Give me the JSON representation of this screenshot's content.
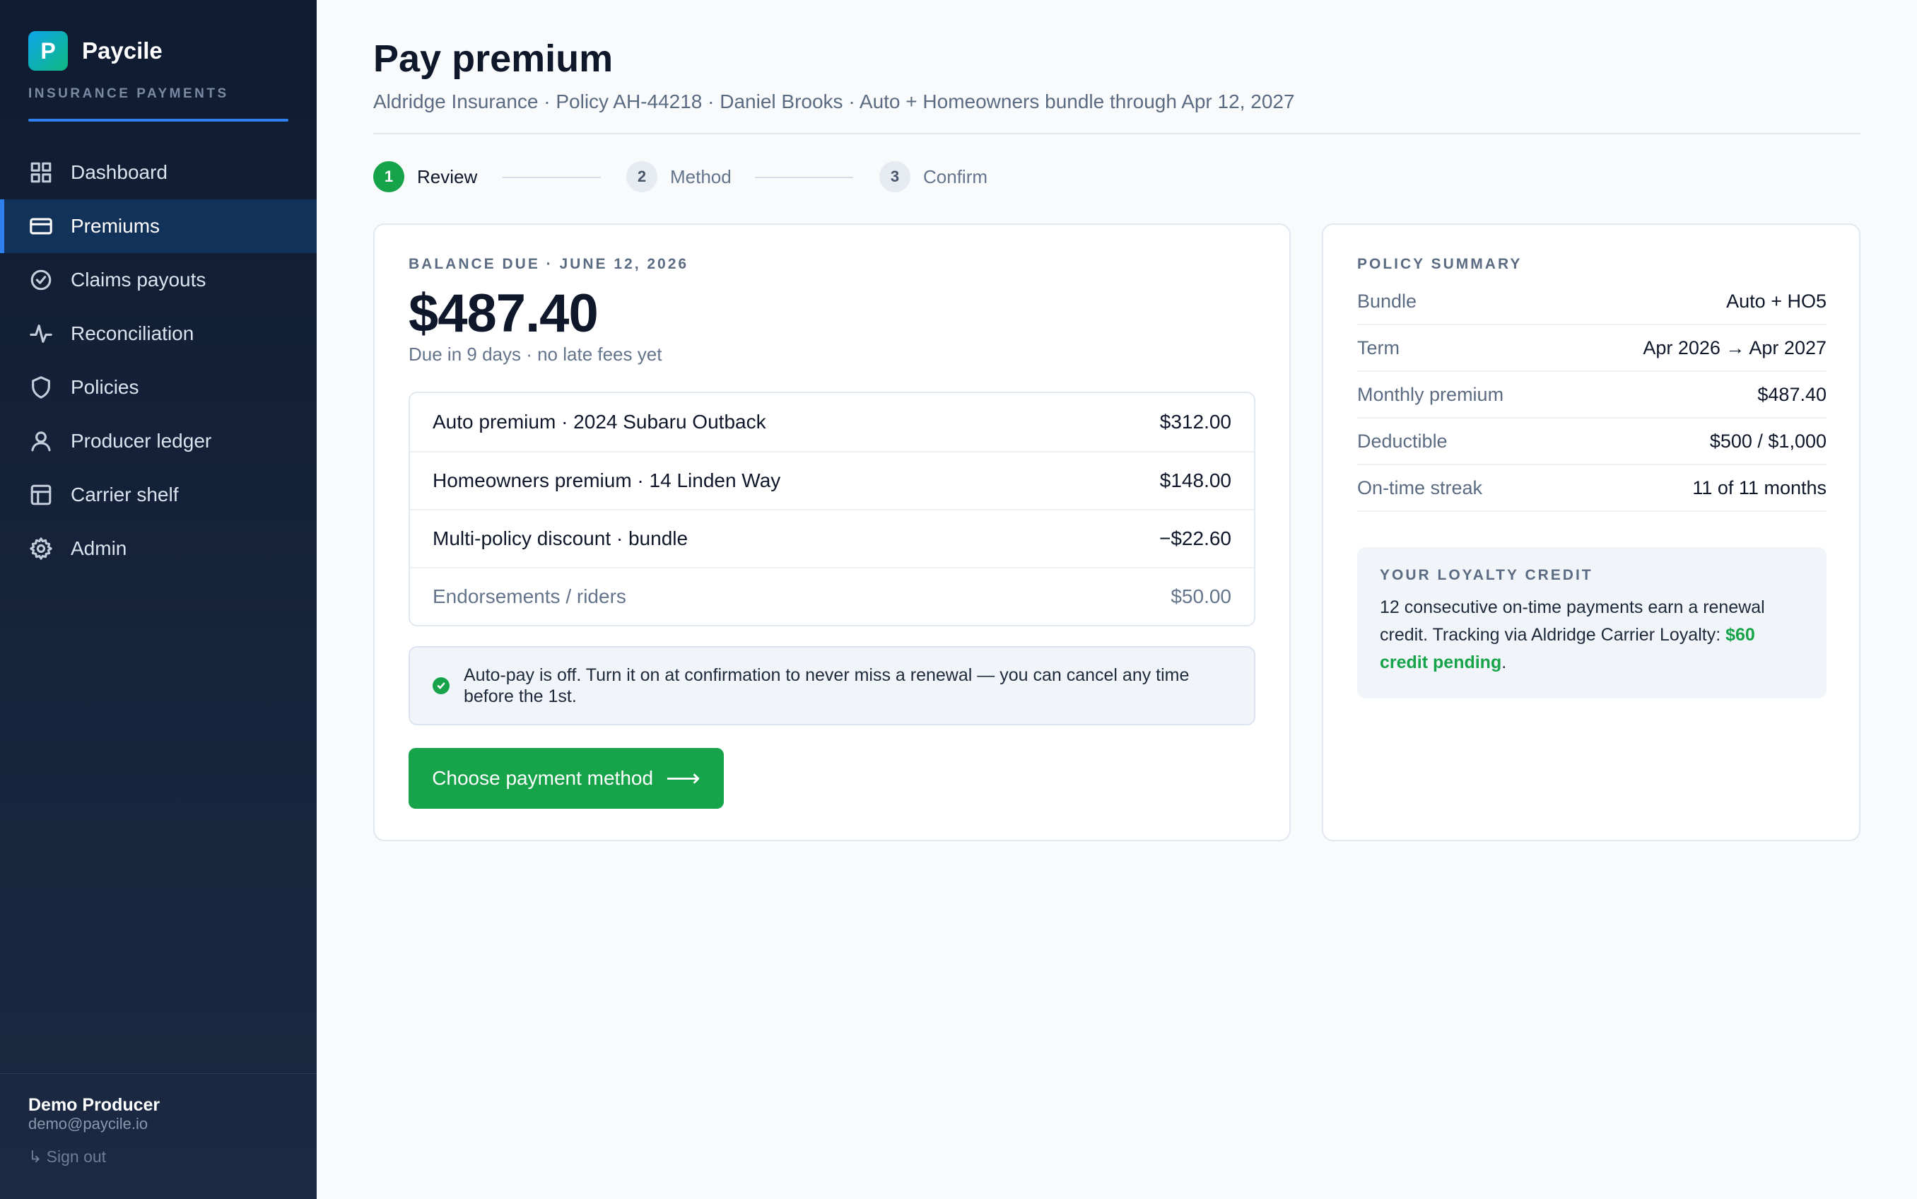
{
  "brand": {
    "logo_letter": "P",
    "name": "Paycile",
    "subtitle": "INSURANCE PAYMENTS",
    "accent_color": "#2f7ff0"
  },
  "sidebar": {
    "items": [
      {
        "label": "Dashboard",
        "icon": "grid-icon",
        "active": false
      },
      {
        "label": "Premiums",
        "icon": "card-icon",
        "active": true
      },
      {
        "label": "Claims payouts",
        "icon": "check-circle-icon",
        "active": false
      },
      {
        "label": "Reconciliation",
        "icon": "pulse-icon",
        "active": false
      },
      {
        "label": "Policies",
        "icon": "shield-icon",
        "active": false
      },
      {
        "label": "Producer ledger",
        "icon": "user-icon",
        "active": false
      },
      {
        "label": "Carrier shelf",
        "icon": "table-icon",
        "active": false
      },
      {
        "label": "Admin",
        "icon": "gear-icon",
        "active": false
      }
    ],
    "user": {
      "name": "Demo Producer",
      "email": "demo@paycile.io",
      "signout": "↳ Sign out"
    }
  },
  "header": {
    "title": "Pay premium",
    "subtitle": "Aldridge Insurance · Policy AH-44218 · Daniel Brooks · Auto + Homeowners bundle through Apr 12, 2027"
  },
  "stepper": {
    "steps": [
      {
        "number": "1",
        "label": "Review",
        "active": true
      },
      {
        "number": "2",
        "label": "Method",
        "active": false
      },
      {
        "number": "3",
        "label": "Confirm",
        "active": false
      }
    ]
  },
  "balance": {
    "eyebrow": "BALANCE DUE · JUNE 12, 2026",
    "amount": "$487.40",
    "note": "Due in 9 days · no late fees yet",
    "lines": [
      {
        "label": "Auto premium · 2024 Subaru Outback",
        "amount": "$312.00",
        "muted": false
      },
      {
        "label": "Homeowners premium · 14 Linden Way",
        "amount": "$148.00",
        "muted": false
      },
      {
        "label": "Multi-policy discount · bundle",
        "amount": "−$22.60",
        "muted": false
      },
      {
        "label": "Endorsements / riders",
        "amount": "$50.00",
        "muted": true
      }
    ],
    "notice": "Auto-pay is off. Turn it on at confirmation to never miss a renewal — you can cancel any time before the 1st.",
    "cta_label": "Choose payment method",
    "cta_arrow": "⟶",
    "cta_color": "#16a34a"
  },
  "policy_summary": {
    "eyebrow": "POLICY SUMMARY",
    "rows": [
      {
        "key": "Bundle",
        "value": "Auto + HO5"
      },
      {
        "key": "Term",
        "value": "Apr 2026 → Apr 2027"
      },
      {
        "key": "Monthly premium",
        "value": "$487.40"
      },
      {
        "key": "Deductible",
        "value": "$500 / $1,000"
      },
      {
        "key": "On-time streak",
        "value": "11 of 11 months"
      }
    ],
    "loyalty": {
      "eyebrow": "YOUR LOYALTY CREDIT",
      "text": "12 consecutive on-time payments earn a renewal credit. Tracking via Aldridge Carrier Loyalty: ",
      "credit": "$60 credit pending",
      "end": "."
    }
  }
}
